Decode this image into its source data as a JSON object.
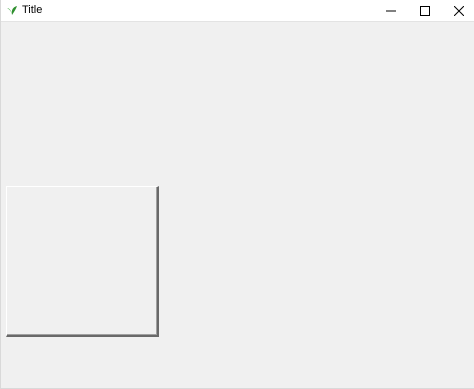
{
  "window": {
    "title": "Title",
    "app_icon": "leaf-icon",
    "controls": {
      "minimize_icon": "minimize-icon",
      "maximize_icon": "maximize-icon",
      "close_icon": "close-icon"
    },
    "colors": {
      "icon_green": "#2e9e2e",
      "background": "#f0f0f0"
    }
  },
  "content": {
    "frame": {
      "style": "raised"
    }
  }
}
